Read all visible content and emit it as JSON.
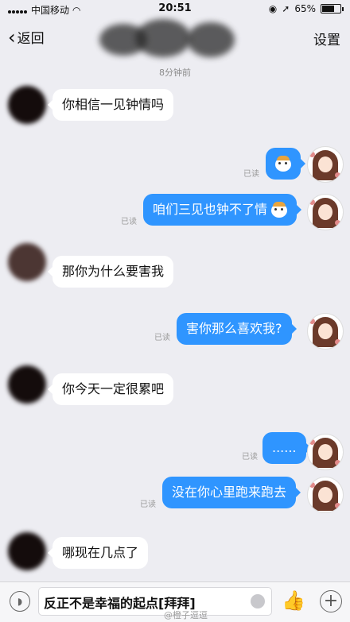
{
  "status_bar": {
    "carrier": "中国移动",
    "time": "20:51",
    "battery_text": "65%"
  },
  "nav": {
    "back_label": "返回",
    "settings_label": "设置"
  },
  "timestamp": "8分钟前",
  "read_label": "已读",
  "messages": [
    {
      "text": "你相信一见钟情吗"
    },
    {
      "text": ""
    },
    {
      "text": "咱们三见也钟不了情"
    },
    {
      "text": "那你为什么要害我"
    },
    {
      "text": "害你那么喜欢我?"
    },
    {
      "text": "你今天一定很累吧"
    },
    {
      "text": "......"
    },
    {
      "text": "没在你心里跑来跑去"
    },
    {
      "text": "哪现在几点了"
    }
  ],
  "input": {
    "value": "反正不是幸福的起点[拜拜]"
  },
  "watermark": "@橙子逗逗"
}
